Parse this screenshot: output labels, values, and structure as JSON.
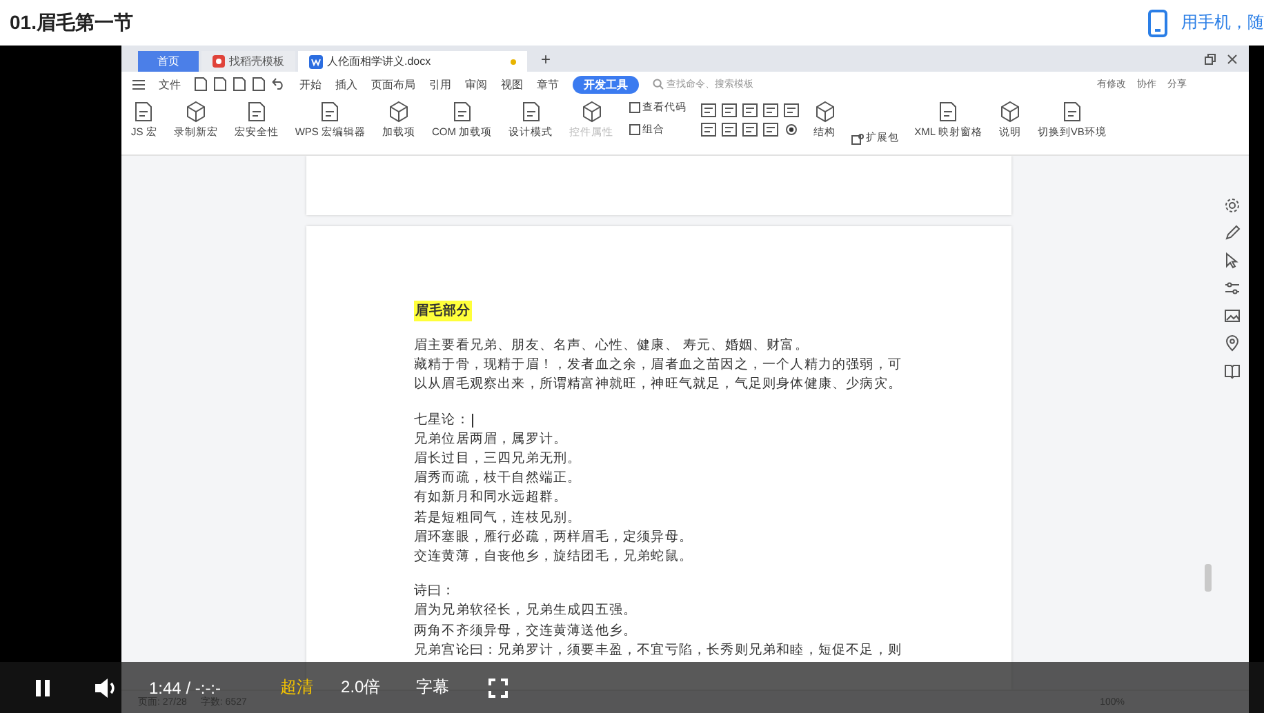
{
  "page": {
    "title": "01.眉毛第一节",
    "mobile_link": "用手机，随"
  },
  "wps": {
    "tabs": [
      {
        "label": "首页",
        "kind": "home",
        "selected": false
      },
      {
        "label": "找稻壳模板",
        "kind": "template",
        "selected": false
      },
      {
        "label": "人伦面相学讲义.docx",
        "kind": "doc",
        "selected": true
      }
    ],
    "new_tab": "+",
    "file_menu": "文件",
    "menu": [
      {
        "label": "开始",
        "selected": false
      },
      {
        "label": "插入",
        "selected": false
      },
      {
        "label": "页面布局",
        "selected": false
      },
      {
        "label": "引用",
        "selected": false
      },
      {
        "label": "审阅",
        "selected": false
      },
      {
        "label": "视图",
        "selected": false
      },
      {
        "label": "章节",
        "selected": false
      },
      {
        "label": "开发工具",
        "selected": true
      }
    ],
    "search_placeholder": "查找命令、搜索模板",
    "actions": [
      "有修改",
      "协作",
      "分享"
    ],
    "ribbon": [
      {
        "kind": "big",
        "label": "JS 宏",
        "disabled": false
      },
      {
        "kind": "big",
        "label": "录制新宏",
        "disabled": false
      },
      {
        "kind": "big",
        "label": "宏安全性",
        "disabled": false
      },
      {
        "kind": "big",
        "label": "WPS 宏编辑器",
        "disabled": false
      },
      {
        "kind": "big",
        "label": "加载项",
        "disabled": false
      },
      {
        "kind": "big",
        "label": "COM 加载项",
        "disabled": false
      },
      {
        "kind": "big",
        "label": "设计模式",
        "disabled": false
      },
      {
        "kind": "big",
        "label": "控件属性",
        "disabled": true
      },
      {
        "kind": "pair",
        "labels": [
          "查看代码",
          "组合"
        ]
      },
      {
        "kind": "grid"
      },
      {
        "kind": "big",
        "label": "结构",
        "disabled": false
      },
      {
        "kind": "small",
        "label": "扩展包"
      },
      {
        "kind": "big",
        "label": "XML 映射窗格",
        "disabled": false
      },
      {
        "kind": "big",
        "label": "说明",
        "disabled": false
      },
      {
        "kind": "big",
        "label": "切换到VB环境",
        "disabled": false
      }
    ],
    "document": {
      "heading": "眉毛部分",
      "blocks": [
        {
          "caret": false,
          "lines": [
            "眉主要看兄弟、朋友、名声、心性、健康、 寿元、婚姻、财富。",
            "藏精于骨，现精于眉！，发者血之余，眉者血之苗因之，一个人精力的强弱，可以从眉毛观察出来，所谓精富神就旺，神旺气就足，气足则身体健康、少病灾。"
          ]
        },
        {
          "caret": true,
          "lines": [
            "七星论：",
            "兄弟位居两眉，属罗计。",
            "眉长过目，三四兄弟无刑。",
            "眉秀而疏，枝干自然端正。",
            "有如新月和同水远超群。",
            "若是短粗同气，连枝见别。",
            "眉环塞眼，雁行必疏，两样眉毛，定须异母。",
            "交连黄薄，自丧他乡，旋结团毛，兄弟蛇鼠。"
          ]
        },
        {
          "caret": false,
          "lines": [
            "诗曰：",
            "眉为兄弟软径长，兄弟生成四五强。",
            "两角不齐须异母，交连黄薄送他乡。",
            "兄弟宫论曰：兄弟罗计，须要丰盈，不宜亏陷，长秀则兄弟和睦，短促不足，则"
          ]
        }
      ]
    },
    "status": [
      "页面: 27/28",
      "字数: 6527"
    ],
    "zoom": "100%"
  },
  "player": {
    "playing": true,
    "time": "1:44 / -:-:-",
    "quality": "超清",
    "speed": "2.0倍",
    "subtitles": "字幕"
  }
}
